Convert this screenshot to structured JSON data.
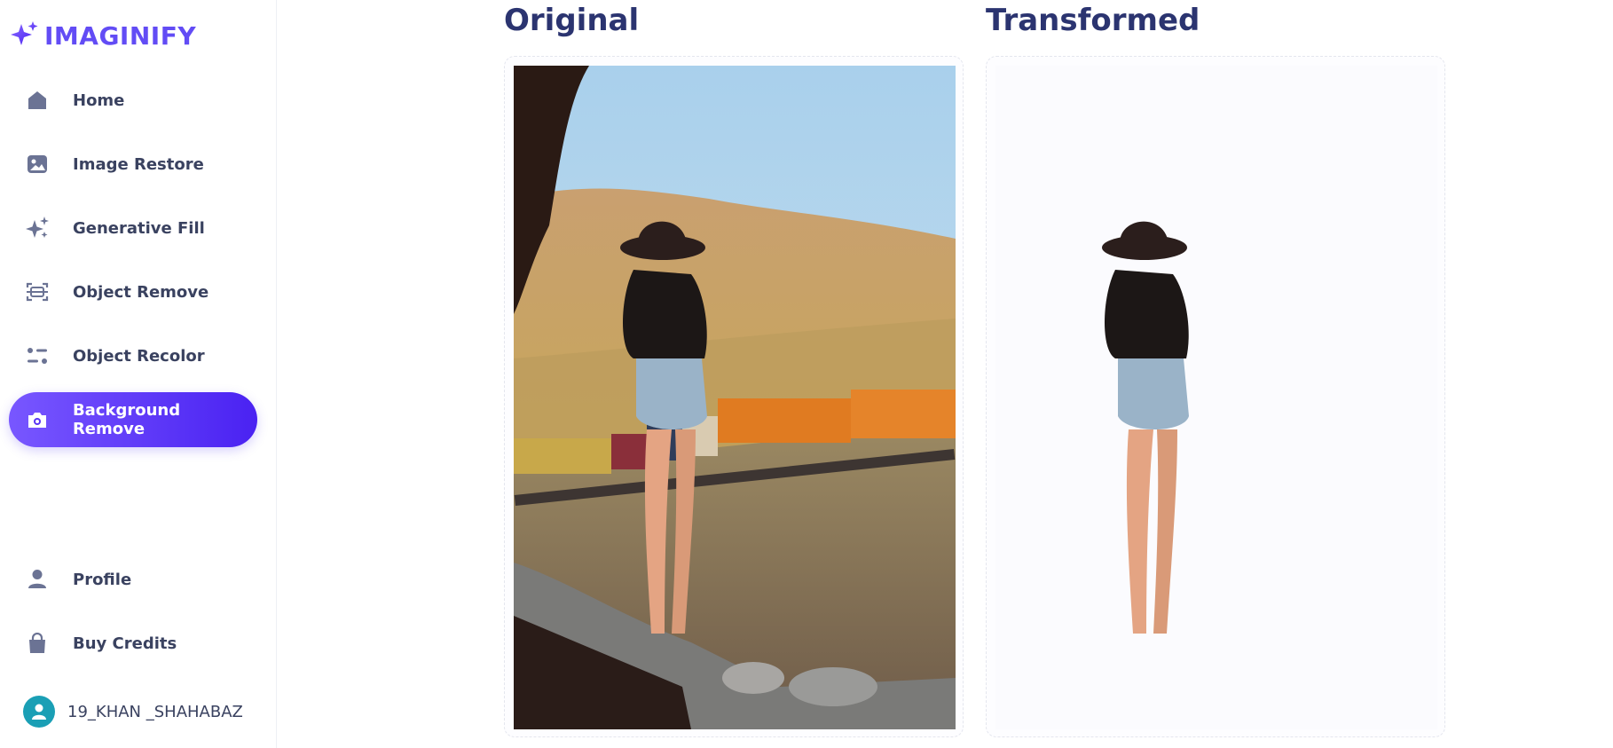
{
  "app": {
    "name": "IMAGINIFY",
    "brand_color": "#624cf5"
  },
  "sidebar": {
    "items": [
      {
        "label": "Home",
        "icon": "home-icon"
      },
      {
        "label": "Image Restore",
        "icon": "image-icon"
      },
      {
        "label": "Generative Fill",
        "icon": "sparkles-icon"
      },
      {
        "label": "Object Remove",
        "icon": "scan-icon"
      },
      {
        "label": "Object Recolor",
        "icon": "filter-icon"
      },
      {
        "label": "Background Remove",
        "icon": "camera-icon",
        "active": true
      }
    ],
    "bottom_items": [
      {
        "label": "Profile",
        "icon": "user-icon"
      },
      {
        "label": "Buy Credits",
        "icon": "bag-icon"
      }
    ],
    "user": {
      "name": "19_KHAN _SHAHABAZ",
      "avatar_color": "#1a9fb5"
    }
  },
  "main": {
    "original_title": "Original",
    "transformed_title": "Transformed"
  }
}
